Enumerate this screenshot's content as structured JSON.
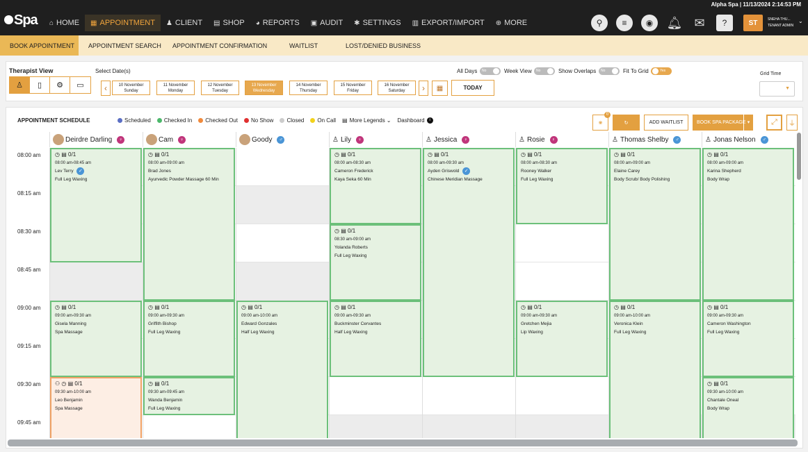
{
  "header": {
    "info": "Alpha Spa | 11/13/2024 2:14:53 PM",
    "logo": "Spa"
  },
  "nav": [
    {
      "label": "HOME",
      "icon": "home-icon",
      "glyph": "⌂"
    },
    {
      "label": "APPOINTMENT",
      "icon": "calendar-icon",
      "glyph": "▦",
      "active": true
    },
    {
      "label": "CLIENT",
      "icon": "client-icon",
      "glyph": "♟"
    },
    {
      "label": "SHOP",
      "icon": "shop-icon",
      "glyph": "▤"
    },
    {
      "label": "REPORTS",
      "icon": "reports-icon",
      "glyph": "◕"
    },
    {
      "label": "AUDIT",
      "icon": "audit-icon",
      "glyph": "▣"
    },
    {
      "label": "SETTINGS",
      "icon": "gear-icon",
      "glyph": "✱"
    },
    {
      "label": "EXPORT/IMPORT",
      "icon": "export-icon",
      "glyph": "▥"
    },
    {
      "label": "MORE",
      "icon": "more-icon",
      "glyph": "⊕"
    }
  ],
  "user": {
    "initials": "ST",
    "name": "SNEHA THU...",
    "role": "TENANT ADMIN"
  },
  "subnav": [
    "BOOK APPOINTMENT",
    "APPOINTMENT SEARCH",
    "APPOINTMENT CONFIRMATION",
    "WAITLIST",
    "LOST/DENIED BUSINESS"
  ],
  "filters": {
    "therapist_view": "Therapist View",
    "select_dates": "Select Date(s)",
    "dates": [
      {
        "day": "10 November",
        "weekday": "Sunday"
      },
      {
        "day": "11 November",
        "weekday": "Monday"
      },
      {
        "day": "12 November",
        "weekday": "Tuesday"
      },
      {
        "day": "13 November",
        "weekday": "Wednesday",
        "selected": true
      },
      {
        "day": "14 November",
        "weekday": "Thursday"
      },
      {
        "day": "15 November",
        "weekday": "Friday"
      },
      {
        "day": "16 November",
        "weekday": "Saturday"
      }
    ],
    "today": "TODAY",
    "toggles": [
      {
        "label": "All Days",
        "value": "No",
        "on": false
      },
      {
        "label": "Week View",
        "value": "No",
        "on": false
      },
      {
        "label": "Show Overlaps",
        "value": "No",
        "on": false
      },
      {
        "label": "Fit To Grid",
        "value": "Yes",
        "on": true
      }
    ],
    "grid_time": "Grid Time"
  },
  "schedule": {
    "title": "APPOINTMENT SCHEDULE",
    "legend": [
      {
        "label": "Scheduled",
        "color": "#5b6fc4"
      },
      {
        "label": "Checked In",
        "color": "#4cb86b"
      },
      {
        "label": "Checked Out",
        "color": "#f08a3c"
      },
      {
        "label": "No Show",
        "color": "#e03030"
      },
      {
        "label": "Closed",
        "color": "#cccccc"
      },
      {
        "label": "On Call",
        "color": "#f2d21c"
      }
    ],
    "more_legends": "More Legends",
    "dashboard": "Dashboard",
    "badge": "0",
    "add_waitlist": "ADD WAITLIST",
    "book_package": "BOOK SPA PACKAGE",
    "times": [
      "08:00 am",
      "08:15 am",
      "08:30 am",
      "08:45 am",
      "09:00 am",
      "09:15 am",
      "09:30 am",
      "09:45 am"
    ],
    "therapists": [
      {
        "name": "Deirdre Darling",
        "gender": "f",
        "photo": true
      },
      {
        "name": "Cam",
        "gender": "f",
        "photo": true
      },
      {
        "name": "Goody",
        "gender": "m",
        "photo": true
      },
      {
        "name": "Lily",
        "gender": "f",
        "photo": false
      },
      {
        "name": "Jessica",
        "gender": "f",
        "photo": false
      },
      {
        "name": "Rosie",
        "gender": "f",
        "photo": false
      },
      {
        "name": "Thomas Shelby",
        "gender": "m",
        "photo": false
      },
      {
        "name": "Jonas Nelson",
        "gender": "m",
        "photo": false
      }
    ],
    "gray_rows": [
      [
        3
      ],
      [],
      [
        1,
        3
      ],
      [
        7
      ],
      [
        7
      ],
      [
        7
      ],
      [
        7
      ],
      [
        7
      ]
    ],
    "appointments": [
      {
        "col": 0,
        "start": 0,
        "span": 3,
        "count": "0/1",
        "time": "08:00 am-08:45 am",
        "client": "Lev Terry",
        "service": "Full Leg Waxing",
        "verified": true
      },
      {
        "col": 0,
        "start": 4,
        "span": 2,
        "count": "0/1",
        "time": "09:00 am-09:30 am",
        "client": "Gisela Manning",
        "service": "Spa Massage"
      },
      {
        "col": 0,
        "start": 6,
        "span": 2,
        "count": "0/1",
        "time": "09:30 am-10:00 am",
        "client": "Leo Benjamin",
        "service": "Spa Massage",
        "orange": true,
        "extra": true
      },
      {
        "col": 1,
        "start": 0,
        "span": 4,
        "count": "0/1",
        "time": "08:00 am-09:00 am",
        "client": "Brad Jones",
        "service": "Ayurvedic Powder Massage 60 Min"
      },
      {
        "col": 1,
        "start": 4,
        "span": 2,
        "count": "0/1",
        "time": "09:00 am-09:30 am",
        "client": "Griffith Bishop",
        "service": "Full Leg Waxing"
      },
      {
        "col": 1,
        "start": 6,
        "span": 1,
        "count": "0/1",
        "time": "09:30 am-09:45 am",
        "client": "Wanda Benjamin",
        "service": "Full Leg Waxing"
      },
      {
        "col": 2,
        "start": 4,
        "span": 4,
        "count": "0/1",
        "time": "09:00 am-10:00 am",
        "client": "Edward Gonzales",
        "service": "Half Leg Waxing"
      },
      {
        "col": 3,
        "start": 0,
        "span": 2,
        "count": "0/1",
        "time": "08:00 am-08:30 am",
        "client": "Cameron Frederick",
        "service": "Kaya Seka 60 Min"
      },
      {
        "col": 3,
        "start": 2,
        "span": 2,
        "count": "0/1",
        "time": "08:30 am-09:00 am",
        "client": "Yolanda Roberts",
        "service": "Full Leg Waxing"
      },
      {
        "col": 3,
        "start": 4,
        "span": 2,
        "count": "0/1",
        "time": "09:00 am-09:30 am",
        "client": "Buckminster Cervantes",
        "service": "Half Leg Waxing"
      },
      {
        "col": 4,
        "start": 0,
        "span": 6,
        "count": "0/1",
        "time": "08:00 am-09:30 am",
        "client": "Ayden Griswold",
        "service": "Chinese Meridian Massage",
        "verified": true
      },
      {
        "col": 5,
        "start": 0,
        "span": 2,
        "count": "0/1",
        "time": "08:00 am-08:30 am",
        "client": "Rooney Walker",
        "service": "Full Leg Waxing"
      },
      {
        "col": 5,
        "start": 4,
        "span": 2,
        "count": "0/1",
        "time": "09:00 am-09:30 am",
        "client": "Gretchen Mejia",
        "service": "Lip Waxing"
      },
      {
        "col": 6,
        "start": 0,
        "span": 4,
        "count": "0/1",
        "time": "08:00 am-09:00 am",
        "client": "Elaine Carey",
        "service": "Body Scrub/ Body Polishing"
      },
      {
        "col": 6,
        "start": 4,
        "span": 4,
        "count": "0/1",
        "time": "09:00 am-10:00 am",
        "client": "Veronica Klein",
        "service": "Full Leg Waxing"
      },
      {
        "col": 7,
        "start": 0,
        "span": 4,
        "count": "0/1",
        "time": "08:00 am-09:00 am",
        "client": "Karina Shepherd",
        "service": "Body Wrap"
      },
      {
        "col": 7,
        "start": 4,
        "span": 2,
        "count": "0/1",
        "time": "09:00 am-09:30 am",
        "client": "Cameron Washington",
        "service": "Full Leg Waxing"
      },
      {
        "col": 7,
        "start": 6,
        "span": 2,
        "count": "0/1",
        "time": "09:30 am-10:00 am",
        "client": "Chantale Oneal",
        "service": "Body Wrap"
      }
    ]
  }
}
